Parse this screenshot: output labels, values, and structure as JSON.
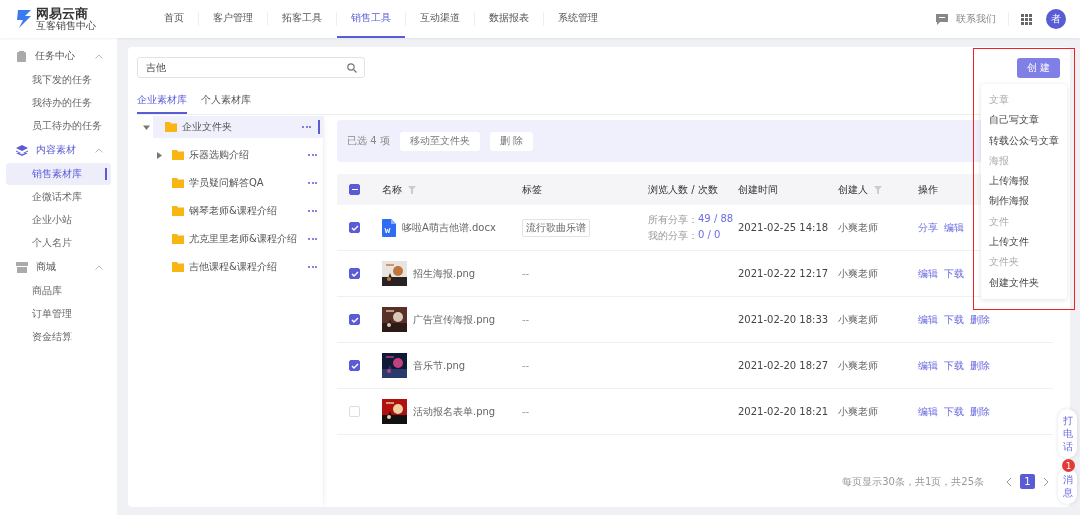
{
  "brand": {
    "name": "网易云商",
    "tagline": "互客销售中心"
  },
  "nav": [
    {
      "label": "首页",
      "selected": false
    },
    {
      "label": "客户管理",
      "selected": false
    },
    {
      "label": "拓客工具",
      "selected": false
    },
    {
      "label": "销售工具",
      "selected": true
    },
    {
      "label": "互动渠道",
      "selected": false
    },
    {
      "label": "数据报表",
      "selected": false
    },
    {
      "label": "系统管理",
      "selected": false
    }
  ],
  "header_actions": {
    "contact": "联系我们",
    "avatar": "者"
  },
  "sidebar": [
    {
      "label": "任务中心",
      "active": false,
      "expanded": true,
      "children": [
        {
          "label": "我下发的任务",
          "selected": false
        },
        {
          "label": "我待办的任务",
          "selected": false
        },
        {
          "label": "员工待办的任务",
          "selected": false
        }
      ]
    },
    {
      "label": "内容素材",
      "active": true,
      "expanded": true,
      "children": [
        {
          "label": "销售素材库",
          "selected": true
        },
        {
          "label": "企微话术库",
          "selected": false
        },
        {
          "label": "企业小站",
          "selected": false
        },
        {
          "label": "个人名片",
          "selected": false
        }
      ]
    },
    {
      "label": "商城",
      "active": false,
      "expanded": true,
      "children": [
        {
          "label": "商品库",
          "selected": false
        },
        {
          "label": "订单管理",
          "selected": false
        },
        {
          "label": "资金结算",
          "selected": false
        }
      ]
    }
  ],
  "search": {
    "value": "吉他"
  },
  "library_tabs": [
    {
      "label": "企业素材库",
      "selected": true
    },
    {
      "label": "个人素材库",
      "selected": false
    }
  ],
  "folders": [
    {
      "label": "企业文件夹",
      "expanded": true,
      "selected": true,
      "children": [
        {
          "label": "乐器选购介绍",
          "expandable": true,
          "selected": false
        },
        {
          "label": "学员疑问解答QA",
          "expandable": false,
          "selected": false
        },
        {
          "label": "钢琴老师&课程介绍",
          "expandable": false,
          "selected": false
        },
        {
          "label": "尤克里里老师&课程介绍",
          "expandable": false,
          "selected": false
        },
        {
          "label": "吉他课程&课程介绍",
          "expandable": false,
          "selected": false
        }
      ]
    }
  ],
  "batch_bar": {
    "count_text": "已选 4 项",
    "buttons": [
      "移动至文件夹",
      "删 除"
    ]
  },
  "table": {
    "select_all_indeterminate": true,
    "columns": [
      {
        "label": "名称",
        "filter": true
      },
      {
        "label": "标签",
        "filter": false
      },
      {
        "label": "浏览人数 / 次数",
        "filter": false
      },
      {
        "label": "创建时间",
        "filter": false
      },
      {
        "label": "创建人",
        "filter": true
      },
      {
        "label": "操作",
        "filter": false
      }
    ],
    "rows": [
      {
        "selected": true,
        "kind": "doc",
        "name": "哆啦A萌吉他谱.docx",
        "tag": "流行歌曲乐谱",
        "views": [
          {
            "label": "所有分享：",
            "value": "49 / 88"
          },
          {
            "label": "我的分享：",
            "value": "0 / 0"
          }
        ],
        "time": "2021-02-25 14:18",
        "creator": "小爽老师",
        "actions": [
          "分享",
          "编辑"
        ]
      },
      {
        "selected": true,
        "name": "招生海报.png",
        "tag": "--",
        "time": "2021-02-22 12:17",
        "creator": "小爽老师",
        "actions": [
          "编辑",
          "下载"
        ]
      },
      {
        "selected": true,
        "name": "广告宣传海报.png",
        "tag": "--",
        "time": "2021-02-20 18:33",
        "creator": "小爽老师",
        "actions": [
          "编辑",
          "下载",
          "删除"
        ]
      },
      {
        "selected": true,
        "name": "音乐节.png",
        "tag": "--",
        "time": "2021-02-20 18:27",
        "creator": "小爽老师",
        "actions": [
          "编辑",
          "下载",
          "删除"
        ]
      },
      {
        "selected": false,
        "name": "活动报名表单.png",
        "tag": "--",
        "time": "2021-02-20 18:21",
        "creator": "小爽老师",
        "actions": [
          "编辑",
          "下载",
          "删除"
        ]
      }
    ]
  },
  "pagination": {
    "summary": "每页显示30条，共1页，共25条",
    "pages": [
      {
        "label": "1",
        "selected": true
      }
    ]
  },
  "create_button": "创 建",
  "create_menu": [
    {
      "kind": "heading",
      "label": "文章"
    },
    {
      "kind": "option",
      "label": "自己写文章"
    },
    {
      "kind": "option",
      "label": "转载公众号文章"
    },
    {
      "kind": "heading",
      "label": "海报"
    },
    {
      "kind": "option",
      "label": "上传海报"
    },
    {
      "kind": "option",
      "label": "制作海报"
    },
    {
      "kind": "heading",
      "label": "文件"
    },
    {
      "kind": "option",
      "label": "上传文件"
    },
    {
      "kind": "heading",
      "label": "文件夹"
    },
    {
      "kind": "option",
      "label": "创建文件夹"
    }
  ],
  "float_buttons": [
    {
      "label": "打电话"
    },
    {
      "label": "消息",
      "badge": "1"
    }
  ]
}
